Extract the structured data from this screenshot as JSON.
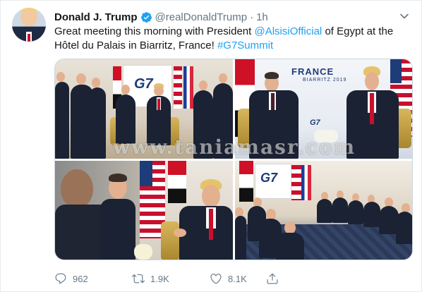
{
  "author": {
    "name": "Donald J. Trump",
    "handle": "@realDonaldTrump",
    "separator": "·",
    "time": "1h"
  },
  "tweet": {
    "text_before": "Great meeting this morning with President ",
    "mention": "@AlsisiOfficial",
    "text_middle": " of Egypt at the Hôtel du Palais in Biarritz, France! ",
    "hashtag": "#G7Summit"
  },
  "media": {
    "watermark": "www.taniamasr.com",
    "banner_france": "FRANCE",
    "banner_biarritz": "BIARRITZ 2019",
    "banner_g7": "G7"
  },
  "actions": {
    "replies": "962",
    "retweets": "1.9K",
    "likes": "8.1K"
  },
  "colors": {
    "link": "#1da1f2",
    "secondary_text": "#657786",
    "border": "#e6ecf0"
  }
}
